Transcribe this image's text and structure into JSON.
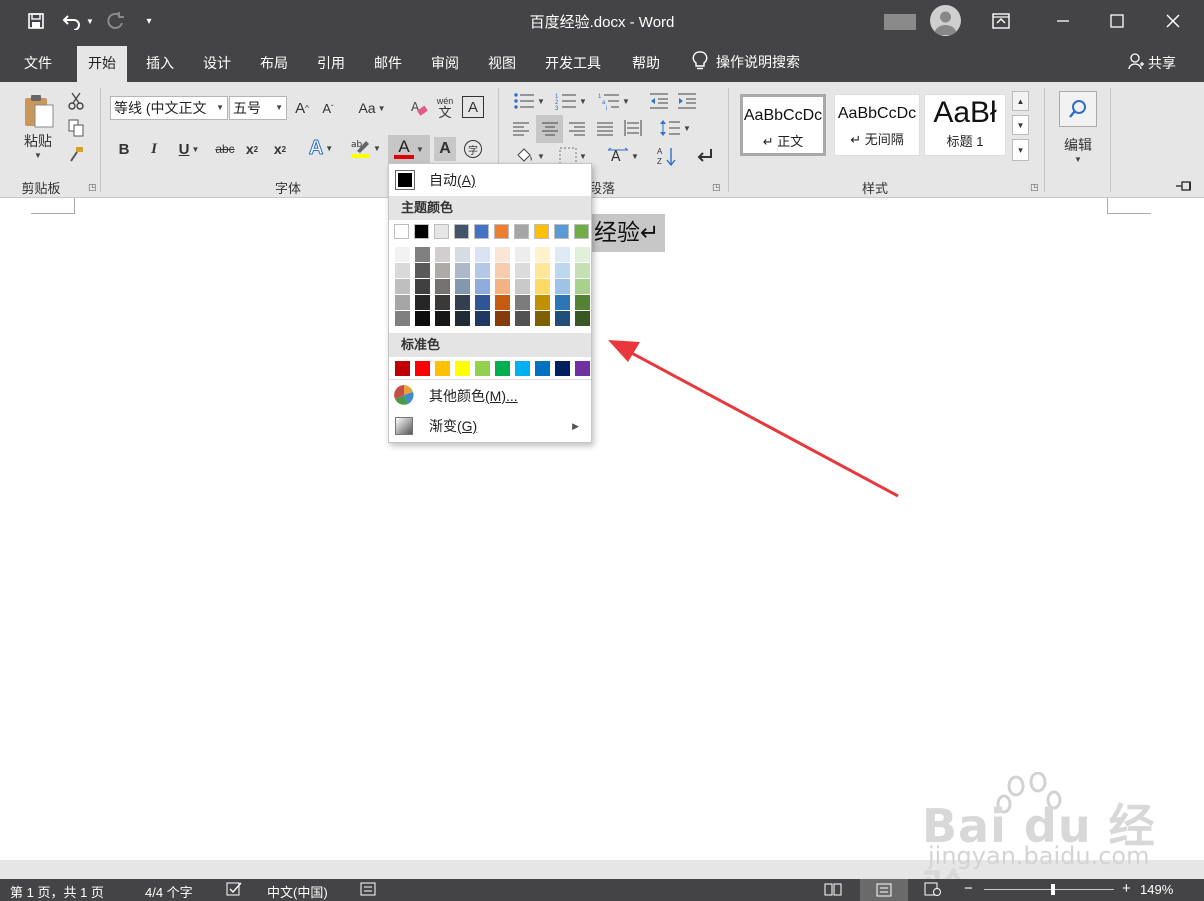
{
  "window": {
    "title": "百度经验.docx  -  Word"
  },
  "tabs": [
    {
      "label": "文件"
    },
    {
      "label": "开始"
    },
    {
      "label": "插入"
    },
    {
      "label": "设计"
    },
    {
      "label": "布局"
    },
    {
      "label": "引用"
    },
    {
      "label": "邮件"
    },
    {
      "label": "审阅"
    },
    {
      "label": "视图"
    },
    {
      "label": "开发工具"
    },
    {
      "label": "帮助"
    }
  ],
  "tell_me": "操作说明搜索",
  "share": "共享",
  "ribbon": {
    "clipboard": {
      "paste_label": "粘贴",
      "group_label": "剪贴板"
    },
    "font": {
      "font_name": "等线 (中文正文",
      "font_size": "五号",
      "change_case": "Aa",
      "bold": "B",
      "italic": "I",
      "underline": "U",
      "strike": "abc",
      "subscript_base": "x",
      "subscript_mark": "2",
      "superscript_base": "x",
      "superscript_mark": "2",
      "group_label": "字体",
      "wen": "文",
      "wen_top": "wén",
      "char_border": "A",
      "char_shading": "A",
      "enclose": "字",
      "grow": "A",
      "shrink": "A",
      "font_color": "A",
      "text_effect": "A"
    },
    "paragraph": {
      "group_label": "段落"
    },
    "styles": {
      "group_label": "样式",
      "items": [
        {
          "sample": "AaBbCcDc",
          "name": "↵ 正文"
        },
        {
          "sample": "AaBbCcDc",
          "name": "↵ 无间隔"
        },
        {
          "sample": "AaBł",
          "name": "标题 1"
        }
      ]
    },
    "editing": {
      "label": "编辑"
    }
  },
  "color_menu": {
    "auto_label": "自动",
    "auto_key": "(A)",
    "theme_header": "主题颜色",
    "standard_header": "标准色",
    "more_colors_label": "其他颜色",
    "more_colors_key": "(M)...",
    "gradient_label": "渐变",
    "gradient_key": "(G)",
    "theme_top": [
      "#ffffff",
      "#000000",
      "#e7e6e6",
      "#44546a",
      "#4472c4",
      "#ed7d31",
      "#a5a5a5",
      "#ffc000",
      "#5b9bd5",
      "#70ad47"
    ],
    "theme_shades": [
      [
        "#f2f2f2",
        "#d9d9d9",
        "#bfbfbf",
        "#a6a6a6",
        "#808080"
      ],
      [
        "#808080",
        "#595959",
        "#404040",
        "#262626",
        "#0d0d0d"
      ],
      [
        "#d0cece",
        "#aeaaaa",
        "#757171",
        "#3b3838",
        "#171616"
      ],
      [
        "#d6dce5",
        "#adb9ca",
        "#8497b0",
        "#333f50",
        "#222a35"
      ],
      [
        "#dae3f3",
        "#b4c7e7",
        "#8faadc",
        "#2f5597",
        "#1f3864"
      ],
      [
        "#fbe5d6",
        "#f8cbad",
        "#f4b183",
        "#c55a11",
        "#843c0c"
      ],
      [
        "#ededed",
        "#dbdbdb",
        "#c9c9c9",
        "#7b7b7b",
        "#525252"
      ],
      [
        "#fff2cc",
        "#ffe699",
        "#ffd966",
        "#bf9000",
        "#7f6000"
      ],
      [
        "#deebf7",
        "#bdd7ee",
        "#9dc3e6",
        "#2e75b6",
        "#1f4e79"
      ],
      [
        "#e2f0d9",
        "#c5e0b4",
        "#a9d18e",
        "#548235",
        "#385723"
      ]
    ],
    "standard": [
      "#c00000",
      "#ff0000",
      "#ffc000",
      "#ffff00",
      "#92d050",
      "#00b050",
      "#00b0f0",
      "#0070c0",
      "#002060",
      "#7030a0"
    ]
  },
  "document": {
    "text": "经验↵"
  },
  "status": {
    "page": "第 1 页，共 1 页",
    "words": "4/4 个字",
    "language": "中文(中国)",
    "zoom": "149%",
    "zoom_minus": "−",
    "zoom_plus": "+",
    "zoom_fraction": 0.53
  },
  "watermark": {
    "logo": "Bai du 经验",
    "url": "jingyan.baidu.com"
  },
  "arrow_color": "#e8383d"
}
